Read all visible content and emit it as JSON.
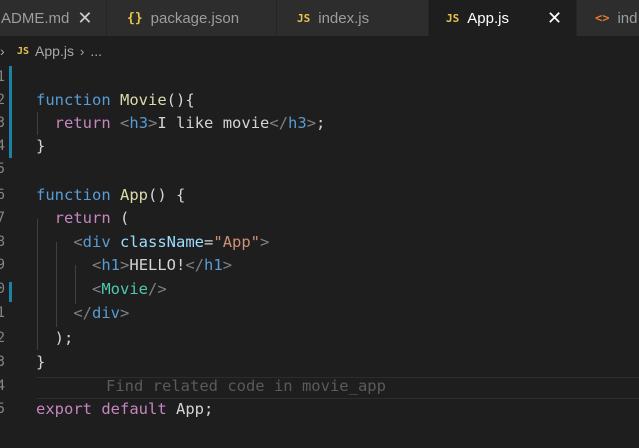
{
  "tabs": [
    {
      "label": "ADME.md",
      "icon": "markdown-icon",
      "close": "✕"
    },
    {
      "label": "package.json",
      "icon": "json-icon",
      "glyph": "{}"
    },
    {
      "label": "index.js",
      "icon": "js-icon",
      "glyph": "JS"
    },
    {
      "label": "App.js",
      "icon": "js-icon",
      "glyph": "JS",
      "active": true,
      "close": "✕"
    },
    {
      "label": "ind",
      "icon": "html-icon",
      "glyph": "<>"
    }
  ],
  "breadcrumb": {
    "chevron": "›",
    "glyph": "JS",
    "file": "App.js",
    "sep": "›",
    "more": "..."
  },
  "line_numbers": [
    "1",
    "2",
    "3",
    "4",
    "5",
    "6",
    "7",
    "8",
    "9",
    "0",
    "1",
    "2",
    "3",
    "4",
    "5"
  ],
  "ghost_text": "Find related code in movie_app",
  "code": {
    "l2": {
      "kw": "function",
      "fn": "Movie",
      "rest": "(){"
    },
    "l3": {
      "kw": "return",
      "open_lt": "<",
      "open_tag": "h3",
      "open_gt": ">",
      "text": "I like movie",
      "close_lt": "</",
      "close_tag": "h3",
      "close_gt": ">",
      "end": ";"
    },
    "l4": "}",
    "l6": {
      "kw": "function",
      "fn": "App",
      "rest": "() {"
    },
    "l7": {
      "kw": "return",
      "rest": " ("
    },
    "l8": {
      "lt": "<",
      "tag": "div",
      "attr": "className",
      "eq": "=",
      "str": "\"App\"",
      "gt": ">"
    },
    "l9": {
      "lt": "<",
      "tag": "h1",
      "gt": ">",
      "text": "HELLO!",
      "clt": "</",
      "ctag": "h1",
      "cgt": ">"
    },
    "l10": {
      "lt": "<",
      "comp": "Movie",
      "gt": "/>"
    },
    "l11": {
      "lt": "</",
      "tag": "div",
      "gt": ">"
    },
    "l12": ");",
    "l13": "}",
    "l15": {
      "kw1": "export",
      "kw2": "default",
      "name": "App",
      "end": ";"
    }
  }
}
